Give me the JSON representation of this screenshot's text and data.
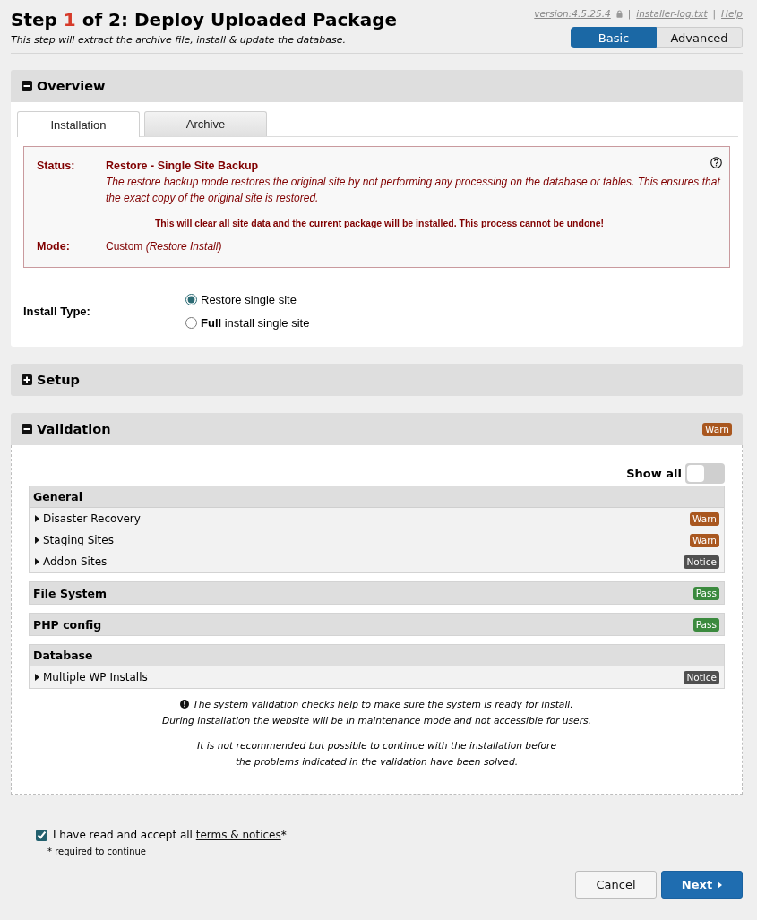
{
  "header": {
    "title": {
      "before": "Step ",
      "step": "1",
      "after": " of 2: Deploy Uploaded Package"
    },
    "subtitle": "This step will extract the archive file, install & update the database.",
    "meta": [
      {
        "kind": "version",
        "label": "version:4.5.25.4"
      },
      {
        "kind": "separator",
        "label": "|"
      },
      {
        "kind": "link",
        "label": "installer-log.txt"
      },
      {
        "kind": "separator",
        "label": "|"
      },
      {
        "kind": "link",
        "label": "Help"
      }
    ],
    "view_modes": [
      {
        "label": "Basic",
        "selected": true
      },
      {
        "label": "Advanced",
        "selected": false
      }
    ]
  },
  "overview": {
    "title": "Overview",
    "expanded": true,
    "tabs": [
      {
        "label": "Installation",
        "selected": true
      },
      {
        "label": "Archive",
        "selected": false
      }
    ],
    "status_box": {
      "status_label": "Status:",
      "status_title": "Restore - Single Site Backup",
      "status_description": "The restore backup mode restores the original site by not performing any processing on the database or tables. This ensures that the exact copy of the original site is restored.",
      "warning": "This will clear all site data and the current package will be installed. This process cannot be undone!",
      "mode_label": "Mode:",
      "mode_value": "Custom *(Restore Install)*"
    },
    "install_type": {
      "label": "Install Type:",
      "options": [
        {
          "label": "Restore single site",
          "selected": true
        },
        {
          "label": "**Full** install single site",
          "selected": false
        }
      ]
    }
  },
  "setup": {
    "title": "Setup",
    "expanded": false
  },
  "validation": {
    "title": "Validation",
    "expanded": true,
    "badge": {
      "label": "Warn",
      "color": "#a9571f"
    },
    "show_all": {
      "label": "Show all",
      "on": false
    },
    "groups": [
      {
        "title": "General",
        "items": [
          {
            "label": "Disaster Recovery",
            "expanded": false,
            "badge": {
              "label": "Warn",
              "color": "#a9571f"
            }
          },
          {
            "label": "Staging Sites",
            "expanded": false,
            "badge": {
              "label": "Warn",
              "color": "#a9571f"
            }
          },
          {
            "label": "Addon Sites",
            "expanded": false,
            "badge": {
              "label": "Notice",
              "color": "#4f4f4f"
            }
          }
        ]
      },
      {
        "title": "File System",
        "badge": {
          "label": "Pass",
          "color": "#3b8a3e"
        }
      },
      {
        "title": "PHP config",
        "badge": {
          "label": "Pass",
          "color": "#3b8a3e"
        }
      },
      {
        "title": "Database",
        "items": [
          {
            "label": "Multiple WP Installs",
            "expanded": false,
            "badge": {
              "label": "Notice",
              "color": "#4f4f4f"
            }
          }
        ]
      }
    ],
    "notes": [
      {
        "kind": "info",
        "sentences": [
          "The system validation checks help to make sure the system is ready for install.",
          "During installation the website will be in maintenance mode and not accessible for users."
        ]
      },
      {
        "kind": "plain",
        "sentences": [
          "It is not recommended but possible to continue with the installation before\nthe problems indicated in the validation have been solved."
        ]
      }
    ]
  },
  "footer": {
    "accept": {
      "checked": true,
      "before": "I have read and accept all ",
      "link": "terms & notices",
      "after": "*"
    },
    "required_note": "* required to continue",
    "buttons": [
      {
        "kind": "secondary",
        "label": "Cancel"
      },
      {
        "kind": "primary",
        "label": "Next"
      }
    ]
  }
}
